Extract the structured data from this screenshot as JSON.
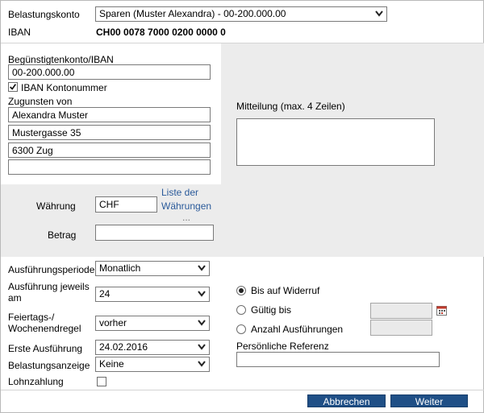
{
  "header": {
    "account_label": "Belastungskonto",
    "account_value": "Sparen (Muster Alexandra) - 00-200.000.00",
    "iban_label": "IBAN",
    "iban_value": "CH00 0078 7000 0200 0000 0"
  },
  "beneficiary": {
    "account_label": "Begünstigtenkonto/IBAN",
    "account_value": "00-200.000.00",
    "iban_checkbox_label": "IBAN Kontonummer",
    "iban_checked": true,
    "in_favor_label": "Zugunsten von",
    "address_lines": [
      "Alexandra Muster",
      "Mustergasse 35",
      "6300 Zug",
      ""
    ]
  },
  "message": {
    "label": "Mitteilung (max. 4 Zeilen)",
    "value": ""
  },
  "currency": {
    "label": "Währung",
    "value": "CHF",
    "list_link_line1": "Liste der",
    "list_link_line2": "Währungen",
    "list_link_more": "...",
    "amount_label": "Betrag",
    "amount_value": ""
  },
  "schedule": {
    "period_label": "Ausführungsperiode",
    "period_value": "Monatlich",
    "each_label_line1": "Ausführung jeweils",
    "each_label_line2": "am",
    "each_value": "24",
    "holiday_label_line1": "Feiertags-/",
    "holiday_label_line2": "Wochenendregel",
    "holiday_value": "vorher",
    "first_label": "Erste Ausführung",
    "first_value": "24.02.2016",
    "debit_notice_label": "Belastungsanzeige",
    "debit_notice_value": "Keine",
    "salary_label": "Lohnzahlung",
    "salary_checked": false
  },
  "validity": {
    "until_revoked_label": "Bis auf Widerruf",
    "valid_until_label": "Gültig bis",
    "executions_label": "Anzahl Ausführungen",
    "selected": "until_revoked",
    "reference_label": "Persönliche Referenz",
    "reference_value": ""
  },
  "actions": {
    "cancel_label": "Abbrechen",
    "next_label": "Weiter"
  },
  "colors": {
    "panel_gray": "#ececec",
    "button_blue": "#1f4f86",
    "link_blue": "#2a5a9a"
  }
}
